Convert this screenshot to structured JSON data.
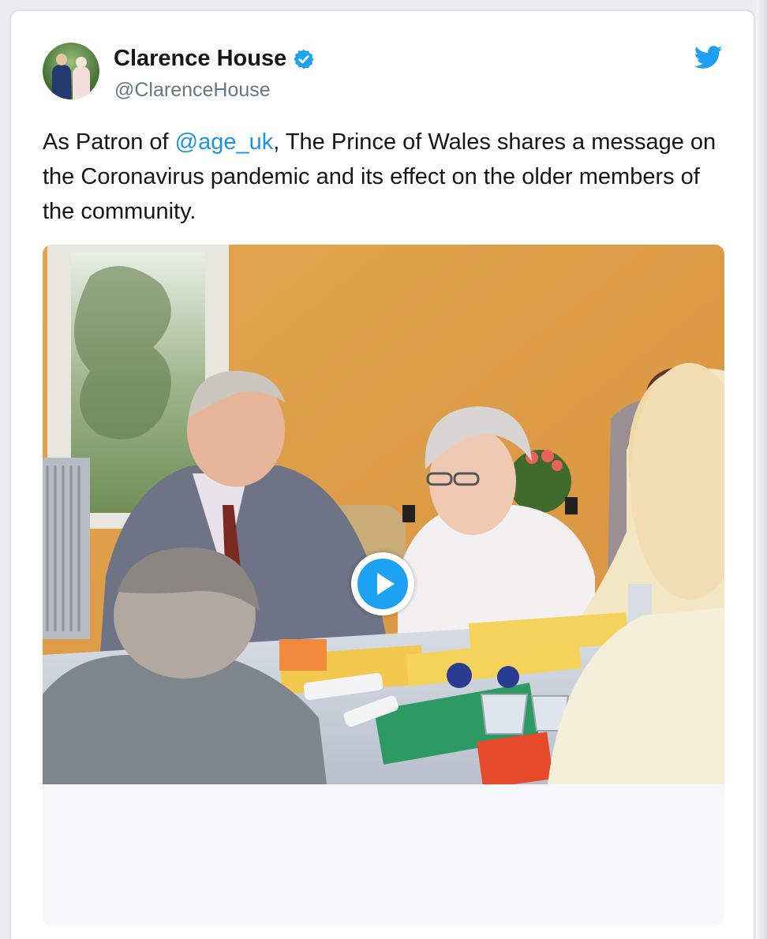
{
  "tweet": {
    "author_name": "Clarence House",
    "author_handle": "@ClarenceHouse",
    "verified": true,
    "text_before": "As Patron of ",
    "mention": "@age_uk",
    "text_after": ", The Prince of Wales shares a message on the Coronavirus pandemic and its effect on the older members of the community."
  },
  "icons": {
    "avatar": "avatar",
    "verified": "verified-badge-icon",
    "brand": "twitter-bird-icon",
    "play": "play-icon"
  },
  "colors": {
    "brand": "#1da1f2",
    "mention": "#1b95e0",
    "text": "#14171a",
    "secondary": "#657786"
  }
}
